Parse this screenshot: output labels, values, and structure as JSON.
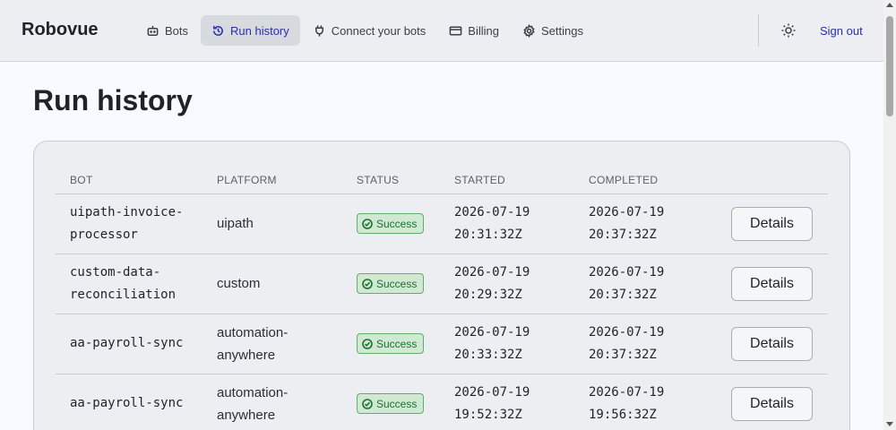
{
  "brand": "Robovue",
  "nav": {
    "items": [
      {
        "label": "Bots",
        "icon": "robot-icon"
      },
      {
        "label": "Run history",
        "icon": "history-icon",
        "active": true
      },
      {
        "label": "Connect your bots",
        "icon": "plug-icon"
      },
      {
        "label": "Billing",
        "icon": "credit-card-icon"
      },
      {
        "label": "Settings",
        "icon": "gear-icon"
      }
    ],
    "theme_icon": "sun-icon",
    "signout": "Sign out"
  },
  "page": {
    "title": "Run history"
  },
  "table": {
    "headers": [
      "BOT",
      "PLATFORM",
      "STATUS",
      "STARTED",
      "COMPLETED"
    ],
    "details_label": "Details",
    "rows": [
      {
        "bot": [
          "uipath-invoice-",
          "processor"
        ],
        "platform": [
          "uipath"
        ],
        "status": "Success",
        "started": [
          "2026-07-19",
          "20:31:32Z"
        ],
        "completed": [
          "2026-07-19",
          "20:37:32Z"
        ]
      },
      {
        "bot": [
          "custom-data-",
          "reconciliation"
        ],
        "platform": [
          "custom"
        ],
        "status": "Success",
        "started": [
          "2026-07-19",
          "20:29:32Z"
        ],
        "completed": [
          "2026-07-19",
          "20:37:32Z"
        ]
      },
      {
        "bot": [
          "aa-payroll-sync"
        ],
        "platform": [
          "automation-",
          "anywhere"
        ],
        "status": "Success",
        "started": [
          "2026-07-19",
          "20:33:32Z"
        ],
        "completed": [
          "2026-07-19",
          "20:37:32Z"
        ]
      },
      {
        "bot": [
          "aa-payroll-sync"
        ],
        "platform": [
          "automation-",
          "anywhere"
        ],
        "status": "Success",
        "started": [
          "2026-07-19",
          "19:52:32Z"
        ],
        "completed": [
          "2026-07-19",
          "19:56:32Z"
        ]
      }
    ]
  },
  "colors": {
    "accent": "#2b2fa6",
    "success_bg": "#cfe9d3",
    "success_text": "#1f6f31"
  }
}
